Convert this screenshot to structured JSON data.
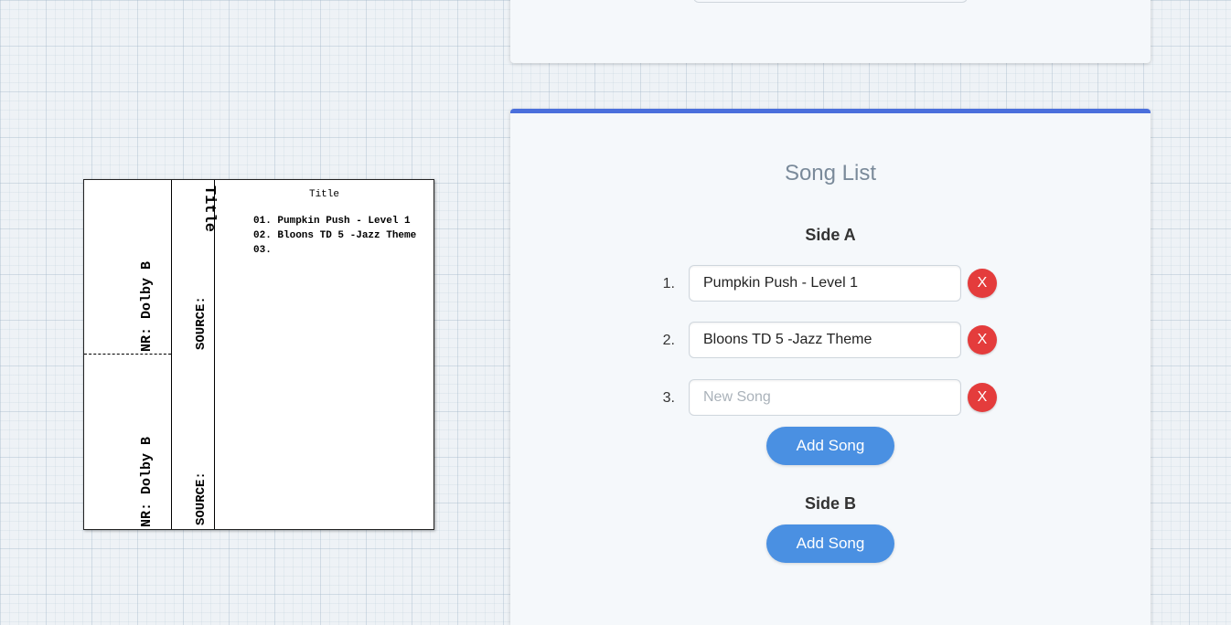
{
  "jcard": {
    "spine": {
      "nr_top": "NR: Dolby B",
      "nr_bottom": "NR: Dolby B",
      "source_top": "SOURCE:",
      "source_bottom": "SOURCE:",
      "title": "Title"
    },
    "title": "Title",
    "tracks": [
      "01. Pumpkin Push - Level 1",
      "02. Bloons TD 5 -Jazz Theme",
      "03."
    ]
  },
  "song_list": {
    "title": "Song List",
    "side_a": {
      "heading": "Side A",
      "songs": [
        {
          "number": "1.",
          "value": "Pumpkin Push - Level 1",
          "placeholder": "New Song",
          "delete_label": "X"
        },
        {
          "number": "2.",
          "value": "Bloons TD 5 -Jazz Theme",
          "placeholder": "New Song",
          "delete_label": "X"
        },
        {
          "number": "3.",
          "value": "",
          "placeholder": "New Song",
          "delete_label": "X"
        }
      ],
      "add_label": "Add Song"
    },
    "side_b": {
      "heading": "Side B",
      "add_label": "Add Song"
    }
  },
  "colors": {
    "accent": "#4a6fdc",
    "add_button": "#4a90e2",
    "delete_button": "#e43c3c"
  }
}
